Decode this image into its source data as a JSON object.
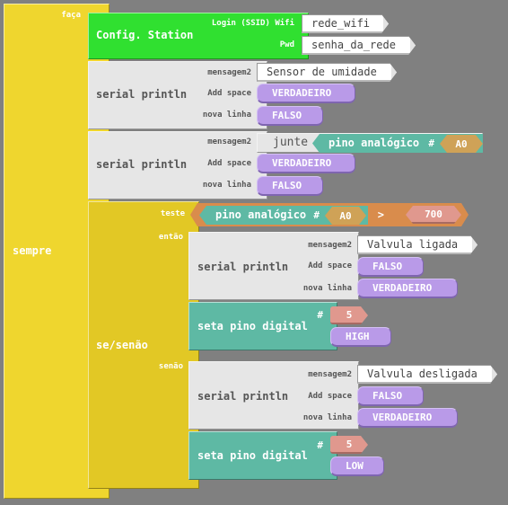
{
  "blocks": {
    "sempre": {
      "label": "sempre",
      "faca": "faça"
    },
    "config": {
      "title": "Config. Station",
      "ssid_label": "Login (SSID) Wifi",
      "ssid_value": "rede_wifi",
      "pwd_label": "Pwd",
      "pwd_value": "senha_da_rede"
    },
    "serial1": {
      "title": "serial println",
      "msg_label": "mensagem2",
      "msg_value": "Sensor de umidade",
      "space_label": "Add space",
      "space_value": "VERDADEIRO",
      "newline_label": "nova linha",
      "newline_value": "FALSO"
    },
    "serial2": {
      "title": "serial println",
      "msg_label": "mensagem2",
      "join_label": "junte",
      "pin_label": "pino analógico",
      "hash": "#",
      "pin_value": "A0",
      "space_label": "Add space",
      "space_value": "VERDADEIRO",
      "newline_label": "nova linha",
      "newline_value": "FALSO"
    },
    "ifelse": {
      "title": "se/senão",
      "test_label": "teste",
      "then_label": "então",
      "else_label": "senão",
      "condition": {
        "pin_label": "pino analógico",
        "hash": "#",
        "pin_value": "A0",
        "operator": ">",
        "number": "700"
      },
      "then_serial": {
        "title": "serial println",
        "msg_label": "mensagem2",
        "msg_value": "Valvula ligada",
        "space_label": "Add space",
        "space_value": "FALSO",
        "newline_label": "nova linha",
        "newline_value": "VERDADEIRO"
      },
      "then_pin": {
        "title": "seta pino digital",
        "hash": "#",
        "pin_value": "5",
        "level_value": "HIGH"
      },
      "else_serial": {
        "title": "serial println",
        "msg_label": "mensagem2",
        "msg_value": "Valvula desligada",
        "space_label": "Add space",
        "space_value": "FALSO",
        "newline_label": "nova linha",
        "newline_value": "VERDADEIRO"
      },
      "else_pin": {
        "title": "seta pino digital",
        "hash": "#",
        "pin_value": "5",
        "level_value": "LOW"
      }
    }
  }
}
